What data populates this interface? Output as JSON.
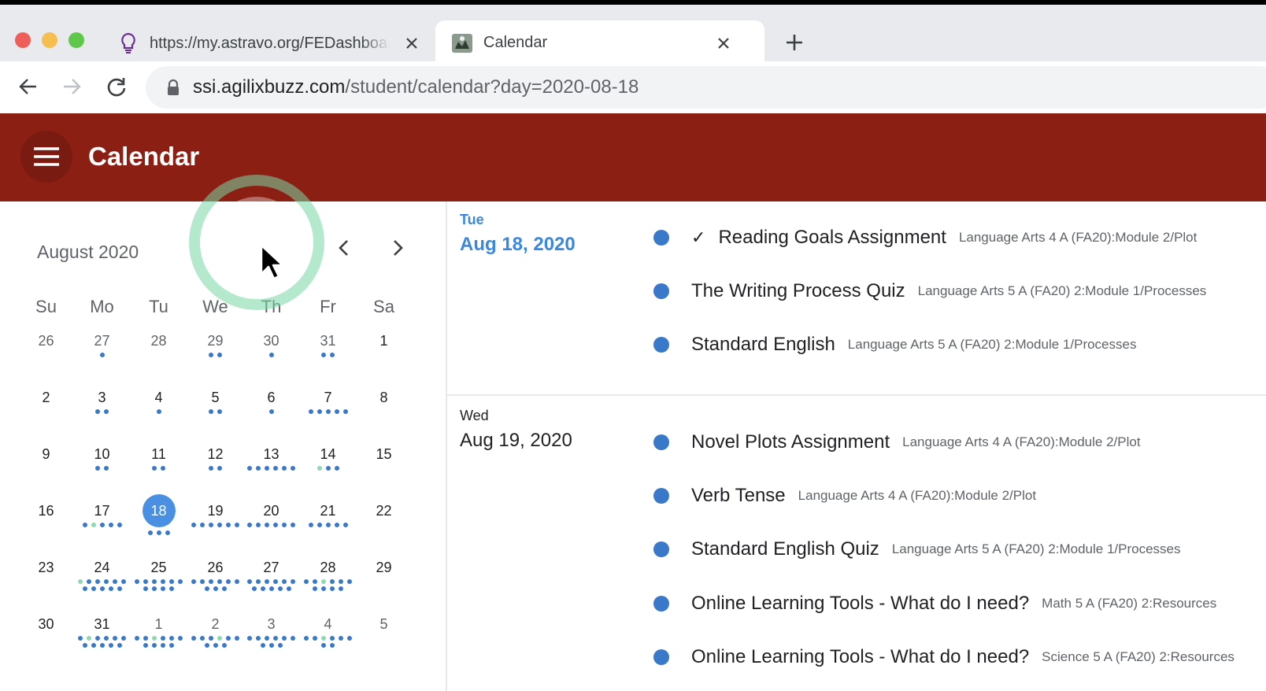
{
  "browser": {
    "tabs": [
      {
        "title": "https://my.astravo.org/FEDashboard",
        "active": false
      },
      {
        "title": "Calendar",
        "active": true
      }
    ],
    "address": {
      "domain": "ssi.agilixbuzz.com",
      "path": "/student/calendar?day=2020-08-18"
    }
  },
  "app": {
    "title": "Calendar",
    "brand_color": "#8c1f13"
  },
  "mini_calendar": {
    "month_label": "August 2020",
    "weekdays": [
      "Su",
      "Mo",
      "Tu",
      "We",
      "Th",
      "Fr",
      "Sa"
    ],
    "weeks": [
      [
        {
          "d": "26",
          "other": true,
          "dots": ""
        },
        {
          "d": "27",
          "other": true,
          "dots": "b"
        },
        {
          "d": "28",
          "other": true,
          "dots": ""
        },
        {
          "d": "29",
          "other": true,
          "dots": "bb"
        },
        {
          "d": "30",
          "other": true,
          "dots": "b"
        },
        {
          "d": "31",
          "other": true,
          "dots": "bb"
        },
        {
          "d": "1",
          "dots": ""
        }
      ],
      [
        {
          "d": "2",
          "dots": ""
        },
        {
          "d": "3",
          "dots": "bb"
        },
        {
          "d": "4",
          "dots": "b"
        },
        {
          "d": "5",
          "dots": "bb"
        },
        {
          "d": "6",
          "dots": "b"
        },
        {
          "d": "7",
          "dots": "bbbbb"
        },
        {
          "d": "8",
          "dots": ""
        }
      ],
      [
        {
          "d": "9",
          "dots": ""
        },
        {
          "d": "10",
          "dots": "bb"
        },
        {
          "d": "11",
          "dots": "bb"
        },
        {
          "d": "12",
          "dots": "bb"
        },
        {
          "d": "13",
          "dots": "bbbbbb"
        },
        {
          "d": "14",
          "dots": "gbb"
        },
        {
          "d": "15",
          "dots": ""
        }
      ],
      [
        {
          "d": "16",
          "dots": ""
        },
        {
          "d": "17",
          "dots": "bgbbb"
        },
        {
          "d": "18",
          "selected": true,
          "dots": "bbb"
        },
        {
          "d": "19",
          "dots": "bbbbbb"
        },
        {
          "d": "20",
          "dots": "bbbbbb"
        },
        {
          "d": "21",
          "dots": "bbbbb"
        },
        {
          "d": "22",
          "dots": ""
        }
      ],
      [
        {
          "d": "23",
          "dots": ""
        },
        {
          "d": "24",
          "dots": "gbbbbbbbbbb"
        },
        {
          "d": "25",
          "dots": "bbbbbbbbbb"
        },
        {
          "d": "26",
          "dots": "bbbbbbbbb"
        },
        {
          "d": "27",
          "dots": "bbbbbbbbbbb"
        },
        {
          "d": "28",
          "dots": "bbgbbbbbbb"
        },
        {
          "d": "29",
          "dots": ""
        }
      ],
      [
        {
          "d": "30",
          "dots": ""
        },
        {
          "d": "31",
          "dots": "bgbbbbbbbbb"
        },
        {
          "d": "1",
          "other": true,
          "dots": "bbgbbbbbbb"
        },
        {
          "d": "2",
          "other": true,
          "dots": "bbbgbbbbb"
        },
        {
          "d": "3",
          "other": true,
          "dots": "bbbbbbbbb"
        },
        {
          "d": "4",
          "other": true,
          "dots": "bbgbbbbb"
        },
        {
          "d": "5",
          "other": true,
          "dots": ""
        }
      ]
    ]
  },
  "agenda": [
    {
      "weekday": "Tue",
      "date": "Aug 18, 2020",
      "today": true,
      "events": [
        {
          "title": "Reading Goals Assignment",
          "course": "Language Arts 4 A (FA20):Module 2/Plot",
          "completed": true
        },
        {
          "title": "The Writing Process Quiz",
          "course": "Language Arts 5 A (FA20) 2:Module 1/Processes"
        },
        {
          "title": "Standard English",
          "course": "Language Arts 5 A (FA20) 2:Module 1/Processes"
        }
      ]
    },
    {
      "weekday": "Wed",
      "date": "Aug 19, 2020",
      "today": false,
      "events": [
        {
          "title": "Novel Plots Assignment",
          "course": "Language Arts 4 A (FA20):Module 2/Plot"
        },
        {
          "title": "Verb Tense",
          "course": "Language Arts 4 A (FA20):Module 2/Plot"
        },
        {
          "title": "Standard English Quiz",
          "course": "Language Arts 5 A (FA20) 2:Module 1/Processes"
        },
        {
          "title": "Online Learning Tools - What do I need?",
          "course": "Math 5 A (FA20) 2:Resources"
        },
        {
          "title": "Online Learning Tools - What do I need?",
          "course": "Science 5 A (FA20) 2:Resources"
        }
      ]
    }
  ]
}
